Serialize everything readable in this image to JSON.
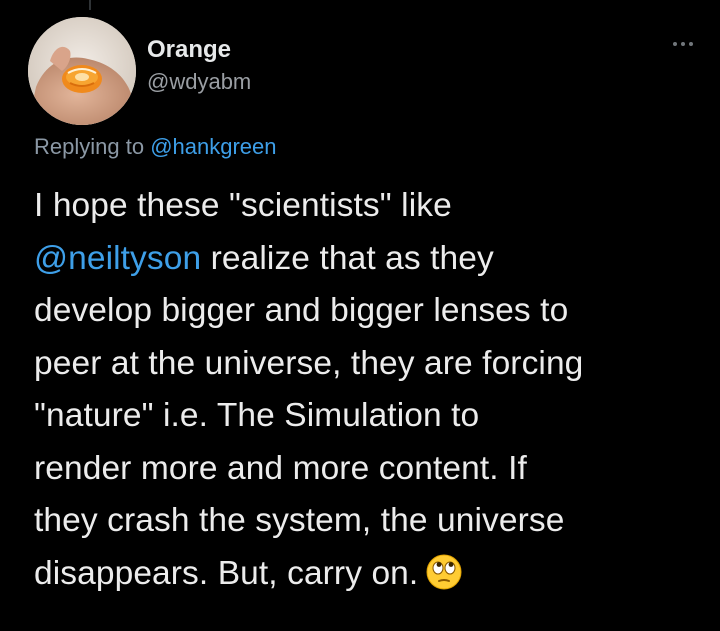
{
  "author": {
    "display_name": "Orange",
    "handle": "@wdyabm"
  },
  "reply": {
    "prefix": "Replying to",
    "mention": "@hankgreen"
  },
  "tweet": {
    "line1": "I hope these \"scientists\" like",
    "mention": "@neiltyson",
    "line2_rest": "realize that as they",
    "line3": "develop bigger and bigger lenses to",
    "line4": "peer at the universe, they are forcing",
    "line5": "\"nature\" i.e. The Simulation to",
    "line6": "render more and more content. If",
    "line7": "they crash the system, the universe",
    "line8": "disappears. But, carry on."
  },
  "icons": {
    "avatar": "avatar-orange-photo",
    "more": "more-options-icon",
    "emoji": "face-with-rolling-eyes-emoji"
  },
  "colors": {
    "background": "#000000",
    "text": "#e7e9ea",
    "secondary_text": "#8b98a5",
    "link": "#3e9fe8"
  }
}
